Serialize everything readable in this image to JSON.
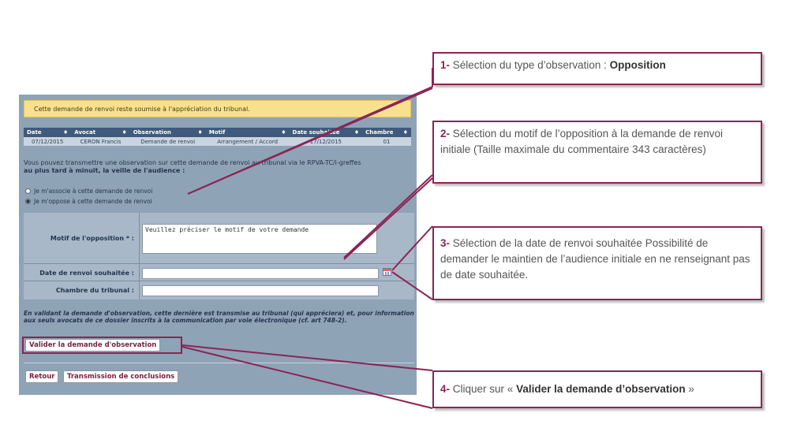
{
  "notice": "Cette demande de renvoi reste soumise à l'appréciation du tribunal.",
  "table": {
    "headers": [
      "Date",
      "Avocat",
      "Observation",
      "Motif",
      "Date souhaitée",
      "Chambre"
    ],
    "rows": [
      [
        "07/12/2015",
        "CERON Francis",
        "Demande de renvoi",
        "Arrangement / Accord",
        "17/12/2015",
        "01"
      ]
    ]
  },
  "info": {
    "text": "Vous pouvez transmettre une observation sur cette demande de renvoi au tribunal via le RPVA-TC/i-greffes",
    "bold": "au plus tard à minuit, la veille de l'audience :"
  },
  "radios": {
    "associate": "Je m'associe à cette demande de renvoi",
    "oppose": "Je m'oppose à cette demande de renvoi",
    "selected": "oppose"
  },
  "form": {
    "motif_label": "Motif de l'opposition * :",
    "motif_placeholder": "Veuillez préciser le motif de votre demande",
    "date_label": "Date de renvoi souhaitée :",
    "date_value": "",
    "chambre_label": "Chambre du tribunal :",
    "chambre_value": ""
  },
  "legal": "En validant la demande d'observation, cette dernière est transmise au tribunal (qui appréciera) et, pour information aux seuls avocats de ce dossier inscrits à la communication par voie électronique (cf. art 748-2).",
  "buttons": {
    "validate": "Valider la demande d'observation",
    "back": "Retour",
    "transmit": "Transmission de conclusions"
  },
  "callouts": {
    "c1_num": "1-",
    "c1_text": " Sélection du type d’observation : ",
    "c1_bold": "Opposition",
    "c2_num": "2-",
    "c2_text": " Sélection du motif de l’opposition à la demande de renvoi initiale (Taille maximale du commentaire 343 caractères)",
    "c3_num": "3-",
    "c3_text": " Sélection de la date de renvoi souhaitée Possibilité de demander le maintien de l’audience initiale en ne renseignant pas de date souhaitée.",
    "c4_num": "4-",
    "c4_text": " Cliquer sur « ",
    "c4_bold": "Valider la demande d’observation",
    "c4_end": " »"
  },
  "colors": {
    "accent": "#8b2454",
    "panel": "#8fa3b7",
    "header": "#3f5a7c",
    "notice": "#f7e18e"
  }
}
